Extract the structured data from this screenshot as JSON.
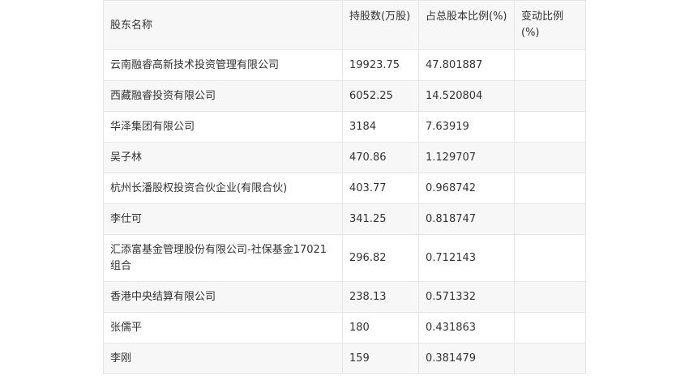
{
  "table": {
    "headers": [
      "股东名称",
      "持股数(万股)",
      "占总股本比例(%)",
      "变动比例(%)"
    ],
    "rows": [
      [
        "云南融睿高新技术投资管理有限公司",
        "19923.75",
        "47.801887",
        ""
      ],
      [
        "西藏融睿投资有限公司",
        "6052.25",
        "14.520804",
        ""
      ],
      [
        "华泽集团有限公司",
        "3184",
        "7.63919",
        ""
      ],
      [
        "吴子林",
        "470.86",
        "1.129707",
        ""
      ],
      [
        "杭州长潘股权投资合伙企业(有限合伙)",
        "403.77",
        "0.968742",
        ""
      ],
      [
        "李仕可",
        "341.25",
        "0.818747",
        ""
      ],
      [
        "汇添富基金管理股份有限公司-社保基金17021组合",
        "296.82",
        "0.712143",
        ""
      ],
      [
        "香港中央结算有限公司",
        "238.13",
        "0.571332",
        ""
      ],
      [
        "张儒平",
        "180",
        "0.431863",
        ""
      ],
      [
        "李刚",
        "159",
        "0.381479",
        ""
      ]
    ]
  }
}
